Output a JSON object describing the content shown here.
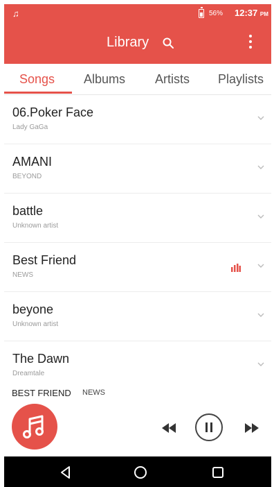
{
  "status_bar": {
    "music_glyph": "♫",
    "battery_percent": "56%",
    "time": "12:37",
    "ampm": "PM"
  },
  "appbar": {
    "title": "Library",
    "search_icon": "search-icon",
    "menu_icon": "more-vert-icon"
  },
  "tabs": [
    {
      "label": "Songs",
      "active": true
    },
    {
      "label": "Albums",
      "active": false
    },
    {
      "label": "Artists",
      "active": false
    },
    {
      "label": "Playlists",
      "active": false
    }
  ],
  "songs": [
    {
      "title": "06.Poker Face",
      "artist": "Lady GaGa",
      "playing": false
    },
    {
      "title": "AMANI",
      "artist": "BEYOND",
      "playing": false
    },
    {
      "title": "battle",
      "artist": "Unknown artist",
      "playing": false
    },
    {
      "title": "Best Friend",
      "artist": "NEWS",
      "playing": true
    },
    {
      "title": "beyone",
      "artist": "Unknown artist",
      "playing": false
    },
    {
      "title": "The Dawn",
      "artist": "Dreamtale",
      "playing": false
    }
  ],
  "now_playing": {
    "title": "BEST FRIEND",
    "artist": "NEWS",
    "state": "playing"
  },
  "colors": {
    "accent": "#e5524a",
    "nav_bg": "#000000"
  }
}
